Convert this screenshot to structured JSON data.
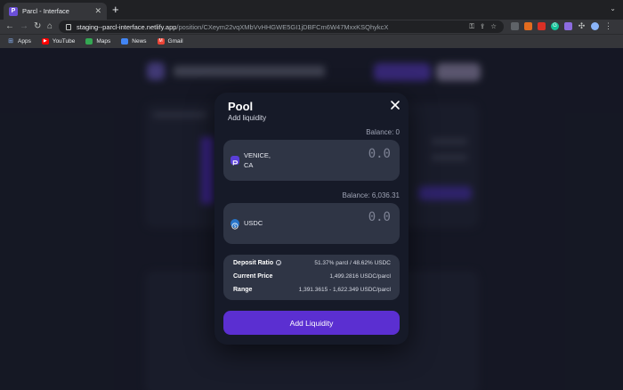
{
  "browser": {
    "tab_title": "Parcl - Interface",
    "url_host": "staging--parcl-interface.netlify.app",
    "url_path": "/position/CXeym22vqXMbVvHHGWE5GI1jDBFCm6W47MxxKSQhykcX",
    "bookmarks": [
      {
        "label": "Apps",
        "icon": "apps-grid-icon",
        "color": "#8ab4f8"
      },
      {
        "label": "YouTube",
        "icon": "youtube-icon",
        "color": "#ff0000"
      },
      {
        "label": "Maps",
        "icon": "maps-icon",
        "color": "#34a853"
      },
      {
        "label": "News",
        "icon": "news-icon",
        "color": "#4285f4"
      },
      {
        "label": "Gmail",
        "icon": "gmail-icon",
        "color": "#ea4335"
      }
    ]
  },
  "modal": {
    "title": "Pool",
    "subtitle": "Add liquidity",
    "asset_a": {
      "balance": "Balance: 0",
      "name_line1": "VENICE,",
      "name_line2": "CA",
      "amount": "0.0",
      "icon": "parcl-logo-icon",
      "icon_color": "#5a3fd8"
    },
    "asset_b": {
      "balance": "Balance: 6,036.31",
      "name": "USDC",
      "amount": "0.0",
      "icon": "usdc-icon",
      "icon_color": "#2775ca"
    },
    "info": {
      "deposit_ratio_label": "Deposit Ratio",
      "deposit_ratio_value": "51.37% parcl / 48.62% USDC",
      "current_price_label": "Current Price",
      "current_price_value": "1,499.2816 USDC/parcl",
      "range_label": "Range",
      "range_value": "1,391.3615 - 1,622.349 USDC/parcl"
    },
    "submit_label": "Add Liquidity",
    "accent": "#5b2fd1"
  }
}
